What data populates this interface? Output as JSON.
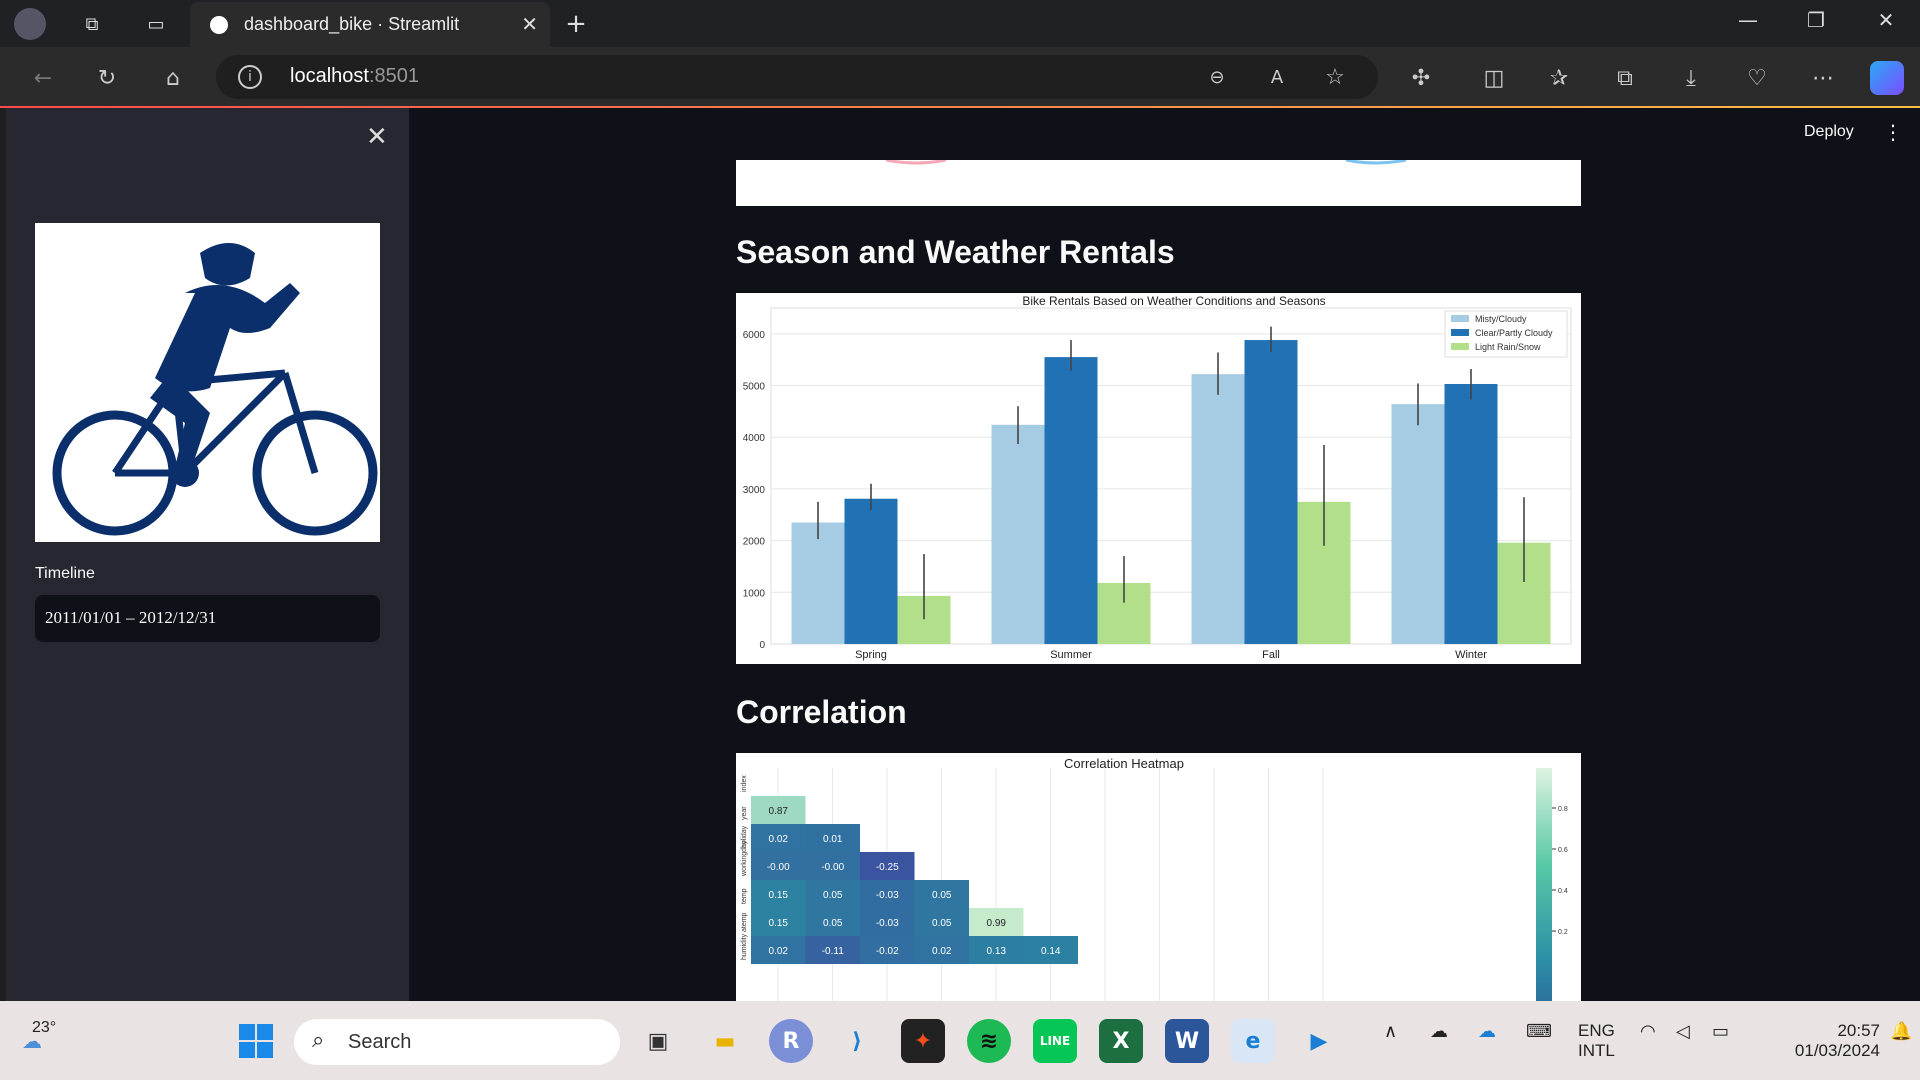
{
  "browser": {
    "tab_title": "dashboard_bike · Streamlit",
    "url_host": "localhost",
    "url_port": ":8501"
  },
  "app": {
    "deploy_label": "Deploy"
  },
  "sidebar": {
    "timeline_label": "Timeline",
    "timeline_value": "2011/01/01 – 2012/12/31"
  },
  "sections": {
    "season_weather_title": "Season and Weather Rentals",
    "correlation_title": "Correlation"
  },
  "chart_data": [
    {
      "type": "bar",
      "title": "Bike Rentals Based on Weather Conditions and Seasons",
      "xlabel": "",
      "ylabel": "",
      "categories": [
        "Spring",
        "Summer",
        "Fall",
        "Winter"
      ],
      "ylim": [
        0,
        6500
      ],
      "yticks": [
        0,
        1000,
        2000,
        3000,
        4000,
        5000,
        6000
      ],
      "legend_position": "top-right",
      "grid": true,
      "series": [
        {
          "name": "Misty/Cloudy",
          "color": "#a6cce3",
          "values": [
            2350,
            4240,
            5220,
            4640
          ],
          "err": [
            [
              2030,
              2750
            ],
            [
              3870,
              4600
            ],
            [
              4820,
              5640
            ],
            [
              4230,
              5040
            ]
          ]
        },
        {
          "name": "Clear/Partly Cloudy",
          "color": "#2171b5",
          "values": [
            2810,
            5550,
            5880,
            5030
          ],
          "err": [
            [
              2590,
              3100
            ],
            [
              5290,
              5880
            ],
            [
              5650,
              6140
            ],
            [
              4730,
              5320
            ]
          ]
        },
        {
          "name": "Light Rain/Snow",
          "color": "#b2df8a",
          "values": [
            930,
            1180,
            2750,
            1960
          ],
          "err": [
            [
              480,
              1740
            ],
            [
              800,
              1700
            ],
            [
              1900,
              3850
            ],
            [
              1200,
              2840
            ]
          ]
        }
      ]
    },
    {
      "type": "heatmap",
      "title": "Correlation Heatmap",
      "row_labels": [
        "index",
        "year",
        "holiday",
        "workingday",
        "temp",
        "atemp",
        "humidity"
      ],
      "rows": [
        [],
        [
          0.87
        ],
        [
          0.02,
          0.01
        ],
        [
          -0.0,
          -0.0,
          -0.25
        ],
        [
          0.15,
          0.05,
          -0.03,
          0.05
        ],
        [
          0.15,
          0.05,
          -0.03,
          0.05,
          0.99
        ],
        [
          0.02,
          -0.11,
          -0.02,
          0.02,
          0.13,
          0.14
        ]
      ],
      "cell_text": [
        [],
        [
          "0.87"
        ],
        [
          "0.02",
          "0.01"
        ],
        [
          "-0.00",
          "-0.00",
          "-0.25"
        ],
        [
          "0.15",
          "0.05",
          "-0.03",
          "0.05"
        ],
        [
          "0.15",
          "0.05",
          "-0.03",
          "0.05",
          "0.99"
        ],
        [
          "0.02",
          "-0.11",
          "-0.02",
          "0.02",
          "0.13",
          "0.14"
        ]
      ],
      "colorbar_ticks": [
        "0.8",
        "0.6",
        "0.4",
        "0.2"
      ]
    }
  ],
  "taskbar": {
    "weather": "23°",
    "search_label": "Search",
    "lang_top": "ENG",
    "lang_bottom": "INTL",
    "time": "20:57",
    "date": "01/03/2024"
  }
}
